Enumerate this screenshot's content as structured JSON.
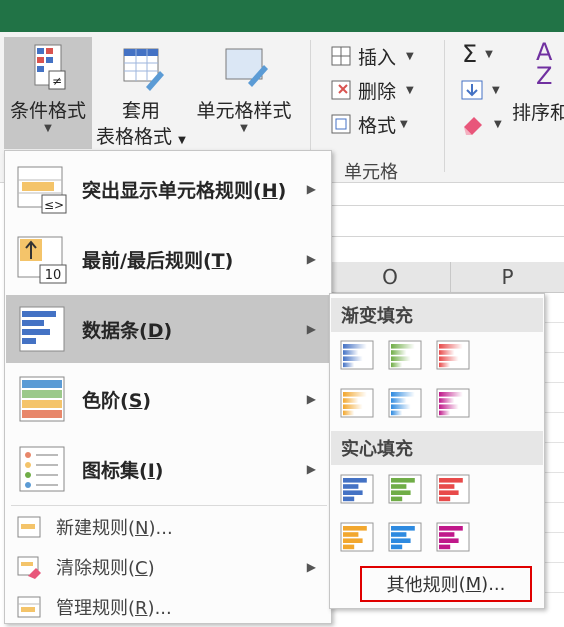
{
  "ribbon": {
    "conditional_formatting": "条件格式",
    "table_format_line1": "套用",
    "table_format_line2": "表格格式",
    "cell_styles": "单元格样式",
    "insert": "插入",
    "delete": "删除",
    "format": "格式",
    "cells_group": "单元格",
    "sort_filter": "排序和",
    "sigma": "Σ"
  },
  "sheet": {
    "columns": [
      "O",
      "P"
    ]
  },
  "menu": {
    "items": [
      {
        "label": "突出显示单元格规则",
        "key": "H"
      },
      {
        "label": "最前/最后规则",
        "key": "T"
      },
      {
        "label": "数据条",
        "key": "D"
      },
      {
        "label": "色阶",
        "key": "S"
      },
      {
        "label": "图标集",
        "key": "I"
      }
    ],
    "actions": [
      {
        "label": "新建规则",
        "key": "N",
        "suffix": "..."
      },
      {
        "label": "清除规则",
        "key": "C",
        "suffix": ""
      },
      {
        "label": "管理规则",
        "key": "R",
        "suffix": "..."
      }
    ]
  },
  "submenu": {
    "gradient_header": "渐变填充",
    "solid_header": "实心填充",
    "colors": [
      "#4472c4",
      "#70ad47",
      "#e84a4a",
      "#f2a72e",
      "#2e8ae0",
      "#c0188a"
    ],
    "more_rules": "其他规则",
    "more_rules_key": "M",
    "more_rules_suffix": "..."
  }
}
